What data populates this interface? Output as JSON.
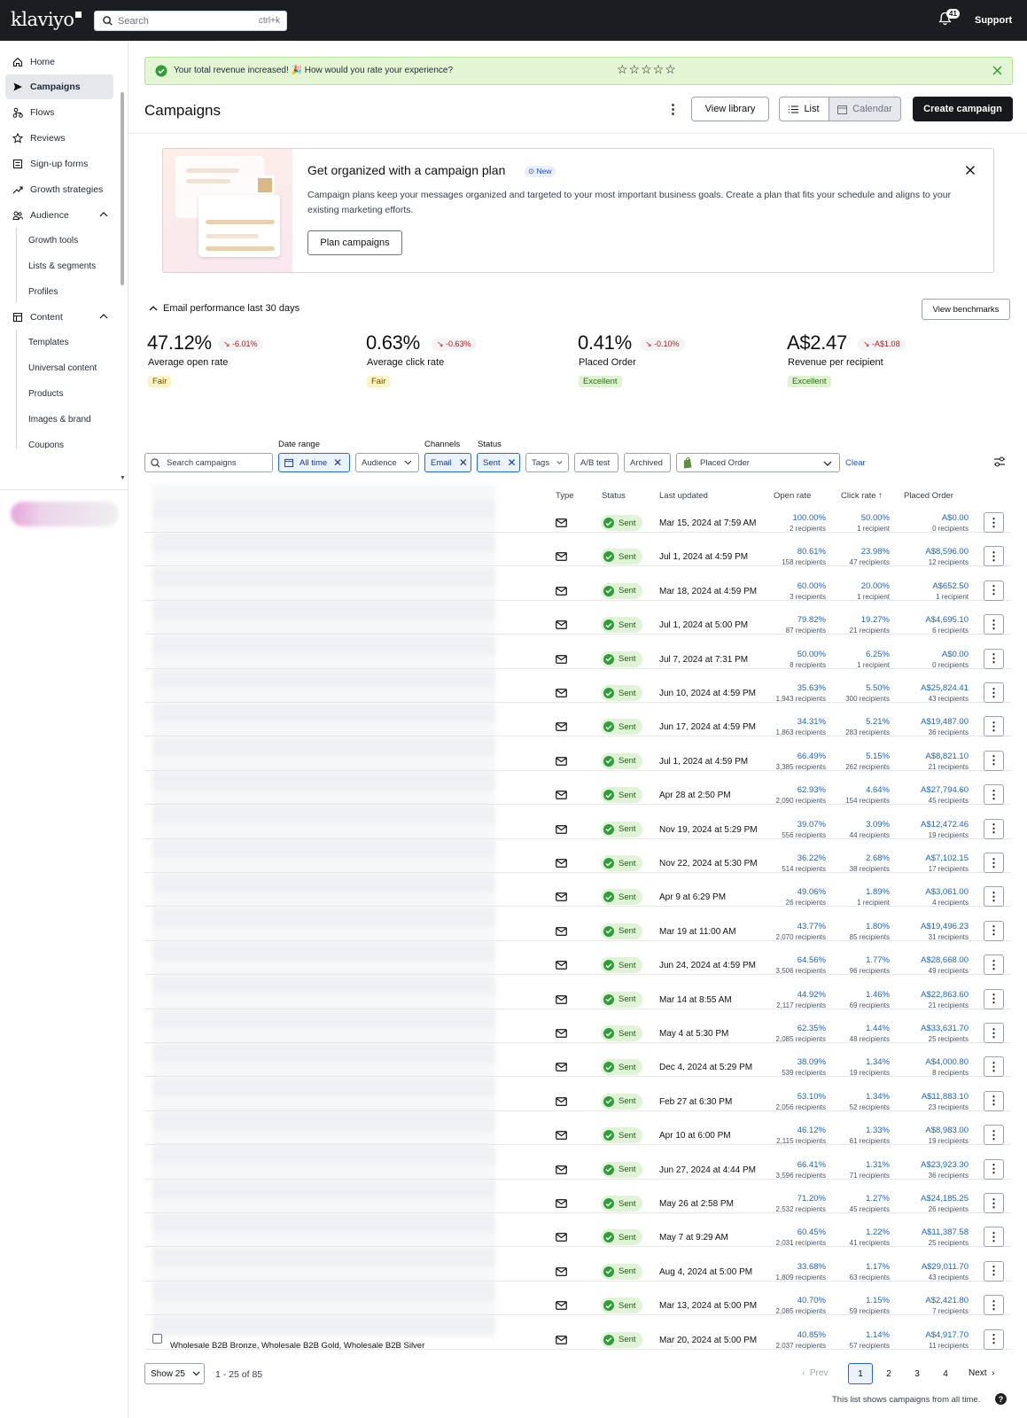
{
  "topbar": {
    "logo": "klaviyo",
    "search_placeholder": "Search",
    "search_shortcut": "ctrl+k",
    "notification_count": "41",
    "support": "Support"
  },
  "sidebar": {
    "items": [
      {
        "label": "Home",
        "icon": "home-icon"
      },
      {
        "label": "Campaigns",
        "icon": "send-icon"
      },
      {
        "label": "Flows",
        "icon": "flows-icon"
      },
      {
        "label": "Reviews",
        "icon": "star-icon"
      },
      {
        "label": "Sign-up forms",
        "icon": "form-icon"
      },
      {
        "label": "Growth strategies",
        "icon": "trend-icon"
      },
      {
        "label": "Audience",
        "icon": "audience-icon"
      },
      {
        "label": "Content",
        "icon": "content-icon"
      }
    ],
    "audience_sub": [
      "Growth tools",
      "Lists & segments",
      "Profiles"
    ],
    "content_sub": [
      "Templates",
      "Universal content",
      "Products",
      "Images & brand",
      "Coupons"
    ]
  },
  "banner": {
    "text": "Your total revenue increased! 🎉 How would you rate your experience?",
    "stars": "☆☆☆☆☆",
    "color": "#e3f6d4"
  },
  "header": {
    "title": "Campaigns",
    "view_library": "View library",
    "list": "List",
    "calendar": "Calendar",
    "create": "Create campaign"
  },
  "plan": {
    "title": "Get organized with a campaign plan",
    "badge": "New",
    "description": "Campaign plans keep your messages organized and targeted to your most important business goals. Create a plan that fits your schedule and aligns to your existing marketing efforts.",
    "button": "Plan campaigns"
  },
  "performance": {
    "heading": "Email performance last 30 days",
    "benchmarks": "View benchmarks",
    "metrics": [
      {
        "value": "47.12%",
        "delta": "-6.01%",
        "label": "Average open rate",
        "rating": "Fair"
      },
      {
        "value": "0.63%",
        "delta": "-0.63%",
        "label": "Average click rate",
        "rating": "Fair"
      },
      {
        "value": "0.41%",
        "delta": "-0.10%",
        "label": "Placed Order",
        "rating": "Excellent"
      },
      {
        "value": "A$2.47",
        "delta": "-A$1.08",
        "label": "Revenue per recipient",
        "rating": "Excellent"
      }
    ]
  },
  "filters": {
    "search_placeholder": "Search campaigns",
    "date_range_label": "Date range",
    "date_range": "All time",
    "audience": "Audience",
    "channels_label": "Channels",
    "channel": "Email",
    "status_label": "Status",
    "status": "Sent",
    "tags": "Tags",
    "ab_test": "A/B test",
    "archived": "Archived",
    "metric": "Placed Order",
    "clear": "Clear"
  },
  "table": {
    "headers": {
      "type": "Type",
      "status": "Status",
      "updated": "Last updated",
      "open": "Open rate",
      "click": "Click rate ↑",
      "order": "Placed Order"
    },
    "rows": [
      {
        "status": "Sent",
        "updated": "Mar 15, 2024 at 7:59 AM",
        "open": "100.00%",
        "open_r": "2 recipients",
        "click": "50.00%",
        "click_r": "1 recipient",
        "order": "A$0.00",
        "order_r": "0 recipients"
      },
      {
        "status": "Sent",
        "updated": "Jul 1, 2024 at 4:59 PM",
        "open": "80.61%",
        "open_r": "158 recipients",
        "click": "23.98%",
        "click_r": "47 recipients",
        "order": "A$8,596.00",
        "order_r": "12 recipients"
      },
      {
        "status": "Sent",
        "updated": "Mar 18, 2024 at 4:59 PM",
        "open": "60.00%",
        "open_r": "3 recipients",
        "click": "20.00%",
        "click_r": "1 recipient",
        "order": "A$652.50",
        "order_r": "1 recipient"
      },
      {
        "status": "Sent",
        "updated": "Jul 1, 2024 at 5:00 PM",
        "open": "79.82%",
        "open_r": "87 recipients",
        "click": "19.27%",
        "click_r": "21 recipients",
        "order": "A$4,695.10",
        "order_r": "6 recipients"
      },
      {
        "status": "Sent",
        "updated": "Jul 7, 2024 at 7:31 PM",
        "open": "50.00%",
        "open_r": "8 recipients",
        "click": "6.25%",
        "click_r": "1 recipient",
        "order": "A$0.00",
        "order_r": "0 recipients"
      },
      {
        "status": "Sent",
        "updated": "Jun 10, 2024 at 4:59 PM",
        "open": "35.63%",
        "open_r": "1,943 recipients",
        "click": "5.50%",
        "click_r": "300 recipients",
        "order": "A$25,824.41",
        "order_r": "43 recipients"
      },
      {
        "status": "Sent",
        "updated": "Jun 17, 2024 at 4:59 PM",
        "open": "34.31%",
        "open_r": "1,863 recipients",
        "click": "5.21%",
        "click_r": "283 recipients",
        "order": "A$19,487.00",
        "order_r": "36 recipients"
      },
      {
        "status": "Sent",
        "updated": "Jul 1, 2024 at 4:59 PM",
        "open": "66.49%",
        "open_r": "3,385 recipients",
        "click": "5.15%",
        "click_r": "262 recipients",
        "order": "A$8,821.10",
        "order_r": "21 recipients"
      },
      {
        "status": "Sent",
        "updated": "Apr 28 at 2:50 PM",
        "open": "62.93%",
        "open_r": "2,090 recipients",
        "click": "4.64%",
        "click_r": "154 recipients",
        "order": "A$27,794.60",
        "order_r": "45 recipients"
      },
      {
        "status": "Sent",
        "updated": "Nov 19, 2024 at 5:29 PM",
        "open": "39.07%",
        "open_r": "556 recipients",
        "click": "3.09%",
        "click_r": "44 recipients",
        "order": "A$12,472.46",
        "order_r": "19 recipients"
      },
      {
        "status": "Sent",
        "updated": "Nov 22, 2024 at 5:30 PM",
        "open": "36.22%",
        "open_r": "514 recipients",
        "click": "2.68%",
        "click_r": "38 recipients",
        "order": "A$7,102.15",
        "order_r": "17 recipients"
      },
      {
        "status": "Sent",
        "updated": "Apr 9 at 6:29 PM",
        "open": "49.06%",
        "open_r": "26 recipients",
        "click": "1.89%",
        "click_r": "1 recipient",
        "order": "A$3,061.00",
        "order_r": "4 recipients"
      },
      {
        "status": "Sent",
        "updated": "Mar 19 at 11:00 AM",
        "open": "43.77%",
        "open_r": "2,070 recipients",
        "click": "1.80%",
        "click_r": "85 recipients",
        "order": "A$19,496.23",
        "order_r": "31 recipients"
      },
      {
        "status": "Sent",
        "updated": "Jun 24, 2024 at 4:59 PM",
        "open": "64.56%",
        "open_r": "3,506 recipients",
        "click": "1.77%",
        "click_r": "96 recipients",
        "order": "A$28,668.00",
        "order_r": "49 recipients"
      },
      {
        "status": "Sent",
        "updated": "Mar 14 at 8:55 AM",
        "open": "44.92%",
        "open_r": "2,117 recipients",
        "click": "1.46%",
        "click_r": "69 recipients",
        "order": "A$22,863.60",
        "order_r": "21 recipients"
      },
      {
        "status": "Sent",
        "updated": "May 4 at 5:30 PM",
        "open": "62.35%",
        "open_r": "2,085 recipients",
        "click": "1.44%",
        "click_r": "48 recipients",
        "order": "A$33,631.70",
        "order_r": "25 recipients"
      },
      {
        "status": "Sent",
        "updated": "Dec 4, 2024 at 5:29 PM",
        "open": "38.09%",
        "open_r": "539 recipients",
        "click": "1.34%",
        "click_r": "19 recipients",
        "order": "A$4,000.80",
        "order_r": "8 recipients"
      },
      {
        "status": "Sent",
        "updated": "Feb 27 at 6:30 PM",
        "open": "53.10%",
        "open_r": "2,056 recipients",
        "click": "1.34%",
        "click_r": "52 recipients",
        "order": "A$11,883.10",
        "order_r": "23 recipients"
      },
      {
        "status": "Sent",
        "updated": "Apr 10 at 6:00 PM",
        "open": "46.12%",
        "open_r": "2,115 recipients",
        "click": "1.33%",
        "click_r": "61 recipients",
        "order": "A$8,983.00",
        "order_r": "19 recipients"
      },
      {
        "status": "Sent",
        "updated": "Jun 27, 2024 at 4:44 PM",
        "open": "66.41%",
        "open_r": "3,596 recipients",
        "click": "1.31%",
        "click_r": "71 recipients",
        "order": "A$23,923.30",
        "order_r": "36 recipients"
      },
      {
        "status": "Sent",
        "updated": "May 26 at 2:58 PM",
        "open": "71.20%",
        "open_r": "2,532 recipients",
        "click": "1.27%",
        "click_r": "45 recipients",
        "order": "A$24,185.25",
        "order_r": "26 recipients"
      },
      {
        "status": "Sent",
        "updated": "May 7 at 9:29 AM",
        "open": "60.45%",
        "open_r": "2,031 recipients",
        "click": "1.22%",
        "click_r": "41 recipients",
        "order": "A$11,387.58",
        "order_r": "25 recipients"
      },
      {
        "status": "Sent",
        "updated": "Aug 4, 2024 at 5:00 PM",
        "open": "33.68%",
        "open_r": "1,809 recipients",
        "click": "1.17%",
        "click_r": "63 recipients",
        "order": "A$29,011.70",
        "order_r": "43 recipients"
      },
      {
        "status": "Sent",
        "updated": "Mar 13, 2024 at 5:00 PM",
        "open": "40.70%",
        "open_r": "2,085 recipients",
        "click": "1.15%",
        "click_r": "59 recipients",
        "order": "A$2,421.80",
        "order_r": "7 recipients"
      },
      {
        "status": "Sent",
        "updated": "Mar 20, 2024 at 5:00 PM",
        "open": "40.85%",
        "open_r": "2,037 recipients",
        "click": "1.14%",
        "click_r": "57 recipients",
        "order": "A$4,917.70",
        "order_r": "11 recipients"
      }
    ],
    "last_row_name": "Wholesale B2B Bronze, Wholesale B2B Gold, Wholesale B2B Silver"
  },
  "pagination": {
    "show": "Show 25",
    "range": "1 - 25 of 85",
    "prev": "Prev",
    "pages": [
      "1",
      "2",
      "3",
      "4"
    ],
    "next": "Next",
    "footer": "This list shows campaigns from all time."
  }
}
